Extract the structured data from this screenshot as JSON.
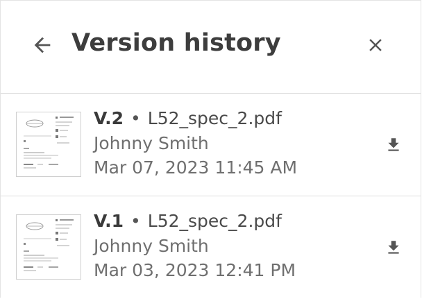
{
  "header": {
    "title": "Version history",
    "back_icon": "arrow-left-icon",
    "close_icon": "close-icon"
  },
  "versions": [
    {
      "label": "V.2",
      "separator": "•",
      "filename": "L52_spec_2.pdf",
      "author": "Johnny Smith",
      "timestamp": "Mar 07, 2023 11:45 AM",
      "download_icon": "download-icon"
    },
    {
      "label": "V.1",
      "separator": "•",
      "filename": "L52_spec_2.pdf",
      "author": "Johnny Smith",
      "timestamp": "Mar 03, 2023 12:41 PM",
      "download_icon": "download-icon"
    }
  ],
  "colors": {
    "text_primary": "#3d3d3d",
    "text_secondary": "#6f6f6f",
    "icon": "#555555",
    "divider": "#dcdcdc"
  }
}
